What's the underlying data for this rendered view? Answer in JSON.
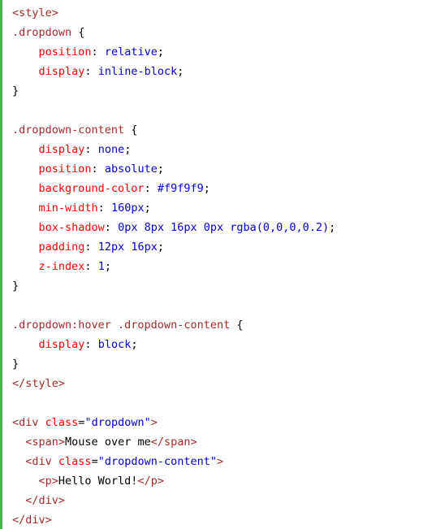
{
  "code": {
    "lines": [
      [
        {
          "t": "<style>",
          "c": "tag"
        }
      ],
      [
        {
          "t": ".dropdown",
          "c": "sel"
        },
        {
          "t": " {",
          "c": "punc"
        }
      ],
      [
        {
          "t": "    ",
          "c": "text"
        },
        {
          "t": "position",
          "c": "prop"
        },
        {
          "t": ": ",
          "c": "punc"
        },
        {
          "t": "relative",
          "c": "val"
        },
        {
          "t": ";",
          "c": "punc"
        }
      ],
      [
        {
          "t": "    ",
          "c": "text"
        },
        {
          "t": "display",
          "c": "prop"
        },
        {
          "t": ": ",
          "c": "punc"
        },
        {
          "t": "inline-block",
          "c": "val"
        },
        {
          "t": ";",
          "c": "punc"
        }
      ],
      [
        {
          "t": "}",
          "c": "punc"
        }
      ],
      [
        {
          "t": "",
          "c": "text"
        }
      ],
      [
        {
          "t": ".dropdown-content",
          "c": "sel"
        },
        {
          "t": " {",
          "c": "punc"
        }
      ],
      [
        {
          "t": "    ",
          "c": "text"
        },
        {
          "t": "display",
          "c": "prop"
        },
        {
          "t": ": ",
          "c": "punc"
        },
        {
          "t": "none",
          "c": "val"
        },
        {
          "t": ";",
          "c": "punc"
        }
      ],
      [
        {
          "t": "    ",
          "c": "text"
        },
        {
          "t": "position",
          "c": "prop"
        },
        {
          "t": ": ",
          "c": "punc"
        },
        {
          "t": "absolute",
          "c": "val"
        },
        {
          "t": ";",
          "c": "punc"
        }
      ],
      [
        {
          "t": "    ",
          "c": "text"
        },
        {
          "t": "background-color",
          "c": "prop"
        },
        {
          "t": ": ",
          "c": "punc"
        },
        {
          "t": "#f9f9f9",
          "c": "val"
        },
        {
          "t": ";",
          "c": "punc"
        }
      ],
      [
        {
          "t": "    ",
          "c": "text"
        },
        {
          "t": "min-width",
          "c": "prop"
        },
        {
          "t": ": ",
          "c": "punc"
        },
        {
          "t": "160px",
          "c": "val"
        },
        {
          "t": ";",
          "c": "punc"
        }
      ],
      [
        {
          "t": "    ",
          "c": "text"
        },
        {
          "t": "box-shadow",
          "c": "prop"
        },
        {
          "t": ": ",
          "c": "punc"
        },
        {
          "t": "0px 8px 16px 0px rgba(0,0,0,0.2)",
          "c": "val"
        },
        {
          "t": ";",
          "c": "punc"
        }
      ],
      [
        {
          "t": "    ",
          "c": "text"
        },
        {
          "t": "padding",
          "c": "prop"
        },
        {
          "t": ": ",
          "c": "punc"
        },
        {
          "t": "12px 16px",
          "c": "val"
        },
        {
          "t": ";",
          "c": "punc"
        }
      ],
      [
        {
          "t": "    ",
          "c": "text"
        },
        {
          "t": "z-index",
          "c": "prop"
        },
        {
          "t": ": ",
          "c": "punc"
        },
        {
          "t": "1",
          "c": "val"
        },
        {
          "t": ";",
          "c": "punc"
        }
      ],
      [
        {
          "t": "}",
          "c": "punc"
        }
      ],
      [
        {
          "t": "",
          "c": "text"
        }
      ],
      [
        {
          "t": ".dropdown:hover .dropdown-content",
          "c": "sel"
        },
        {
          "t": " {",
          "c": "punc"
        }
      ],
      [
        {
          "t": "    ",
          "c": "text"
        },
        {
          "t": "display",
          "c": "prop"
        },
        {
          "t": ": ",
          "c": "punc"
        },
        {
          "t": "block",
          "c": "val"
        },
        {
          "t": ";",
          "c": "punc"
        }
      ],
      [
        {
          "t": "}",
          "c": "punc"
        }
      ],
      [
        {
          "t": "</style>",
          "c": "tag"
        }
      ],
      [
        {
          "t": "",
          "c": "text"
        }
      ],
      [
        {
          "t": "<div",
          "c": "tag"
        },
        {
          "t": " class",
          "c": "attr"
        },
        {
          "t": "=",
          "c": "punc"
        },
        {
          "t": "\"dropdown\"",
          "c": "str"
        },
        {
          "t": ">",
          "c": "tag"
        }
      ],
      [
        {
          "t": "  ",
          "c": "text"
        },
        {
          "t": "<span>",
          "c": "tag"
        },
        {
          "t": "Mouse over me",
          "c": "text"
        },
        {
          "t": "</span>",
          "c": "tag"
        }
      ],
      [
        {
          "t": "  ",
          "c": "text"
        },
        {
          "t": "<div",
          "c": "tag"
        },
        {
          "t": " class",
          "c": "attr"
        },
        {
          "t": "=",
          "c": "punc"
        },
        {
          "t": "\"dropdown-content\"",
          "c": "str"
        },
        {
          "t": ">",
          "c": "tag"
        }
      ],
      [
        {
          "t": "    ",
          "c": "text"
        },
        {
          "t": "<p>",
          "c": "tag"
        },
        {
          "t": "Hello World!",
          "c": "text"
        },
        {
          "t": "</p>",
          "c": "tag"
        }
      ],
      [
        {
          "t": "  ",
          "c": "text"
        },
        {
          "t": "</div>",
          "c": "tag"
        }
      ],
      [
        {
          "t": "</div>",
          "c": "tag"
        }
      ]
    ]
  },
  "colors": {
    "accent_border": "#4caf50",
    "tag": "#a52a2a",
    "selector": "#a52a2a",
    "property": "#ff0000",
    "value": "#0000cd",
    "attribute": "#ff0000",
    "string": "#0000cd",
    "text": "#000000"
  }
}
